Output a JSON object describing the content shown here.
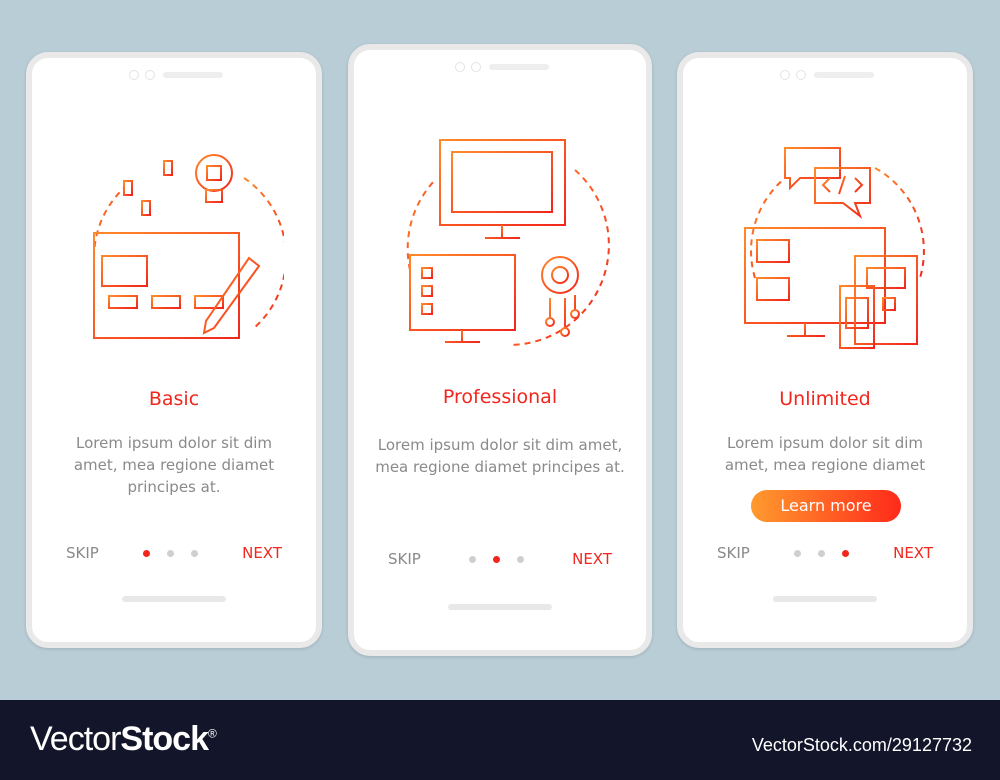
{
  "colors": {
    "accent": "#f2261c",
    "gradient_start": "#ff9a2e",
    "gradient_end": "#ff2a1a",
    "background": "#b9cdd7",
    "footer": "#13162a"
  },
  "screens": [
    {
      "icon": "web-design-icon",
      "title": "Basic",
      "description": "Lorem ipsum dolor sit dim amet, mea regione diamet principes at.",
      "skip": "SKIP",
      "next": "NEXT",
      "active_dot": 1
    },
    {
      "icon": "programming-computers-icon",
      "title": "Professional",
      "description": "Lorem ipsum dolor sit dim amet, mea regione diamet principes at.",
      "skip": "SKIP",
      "next": "NEXT",
      "active_dot": 2
    },
    {
      "icon": "responsive-devices-icon",
      "title": "Unlimited",
      "description": "Lorem ipsum dolor sit dim amet, mea regione diamet",
      "button": "Learn more",
      "skip": "SKIP",
      "next": "NEXT",
      "active_dot": 3
    }
  ],
  "footer": {
    "logo_light": "Vector",
    "logo_bold": "Stock",
    "logo_mark": "®",
    "url": "VectorStock.com/29127732"
  }
}
